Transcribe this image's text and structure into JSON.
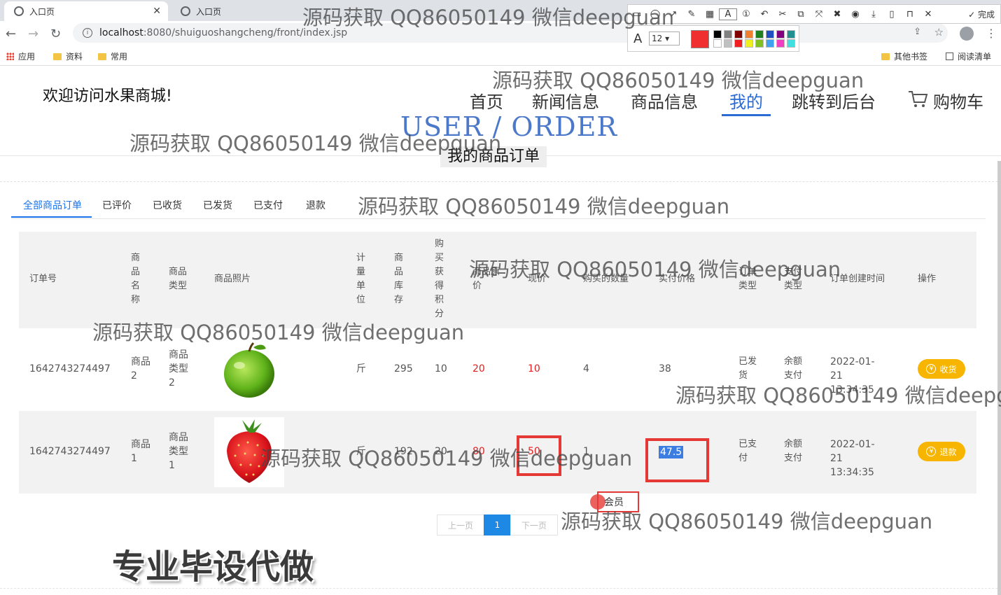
{
  "browser": {
    "tabs": [
      {
        "label": "入口页",
        "active": true
      },
      {
        "label": "入口页",
        "active": false
      }
    ],
    "url_host": "localhost",
    "url_path": ":8080/shuiguoshangcheng/front/index.jsp",
    "bookmarks": {
      "apps": "应用",
      "folder1": "资料",
      "folder2": "常用",
      "other": "其他书签",
      "reading": "阅读清单"
    }
  },
  "screenshot_tool": {
    "font_size": "12",
    "done_label": "完成",
    "active_color": "#f03030",
    "swatches": [
      "#000000",
      "#808080",
      "#800000",
      "#f08030",
      "#208020",
      "#2050c0",
      "#800080",
      "#209090",
      "#ffffff",
      "#c0c0c0",
      "#f02020",
      "#f0f020",
      "#80c020",
      "#40a0f0",
      "#f040c0",
      "#40e0e0"
    ]
  },
  "header": {
    "welcome": "欢迎访问水果商城!",
    "nav": [
      {
        "label": "首页",
        "active": false
      },
      {
        "label": "新闻信息",
        "active": false
      },
      {
        "label": "商品信息",
        "active": false
      },
      {
        "label": "我的",
        "active": true
      },
      {
        "label": "跳转到后台",
        "active": false
      },
      {
        "label": "购物车",
        "active": false
      }
    ]
  },
  "section": {
    "en_title": "USER / ORDER",
    "title": "我的商品订单"
  },
  "order_tabs": [
    {
      "label": "全部商品订单",
      "active": true
    },
    {
      "label": "已评价",
      "active": false
    },
    {
      "label": "已收货",
      "active": false
    },
    {
      "label": "已发货",
      "active": false
    },
    {
      "label": "已支付",
      "active": false
    },
    {
      "label": "退款",
      "active": false
    }
  ],
  "table": {
    "columns": {
      "order_no": "订单号",
      "name": "商品名称",
      "type": "商品类型",
      "photo": "商品照片",
      "unit": "计量单位",
      "stock": "商品库存",
      "points": "购买获得积分",
      "orig_price": "商品原价",
      "cur_price": "现价",
      "qty": "购买的数量",
      "paid": "实付价格",
      "order_type": "订单类型",
      "pay_type": "支付类型",
      "created": "订单创建时间",
      "action": "操作"
    },
    "rows": [
      {
        "order_no": "1642743274497",
        "name": "商品2",
        "type": "商品类型2",
        "photo": "apple-photo",
        "unit": "斤",
        "stock": "295",
        "points": "10",
        "orig_price": "20",
        "cur_price": "10",
        "qty": "4",
        "paid": "38",
        "order_type": "已发货",
        "pay_type": "余额支付",
        "created": "2022-01-21 13:34:35",
        "action": "收货"
      },
      {
        "order_no": "1642743274497",
        "name": "商品1",
        "type": "商品类型1",
        "photo": "strawberry-photo",
        "unit": "斤",
        "stock": "192",
        "points": "20",
        "orig_price": "80",
        "cur_price": "50",
        "qty": "1",
        "paid": "47.5",
        "order_type": "已支付",
        "pay_type": "余额支付",
        "created": "2022-01-21 13:34:35",
        "action": "退款"
      }
    ]
  },
  "pagination": {
    "prev": "上一页",
    "current": "1",
    "next": "下一页"
  },
  "annotation_tag": "会员",
  "promo": "专业毕设代做",
  "watermark": "源码获取 QQ86050149 微信deepguan"
}
